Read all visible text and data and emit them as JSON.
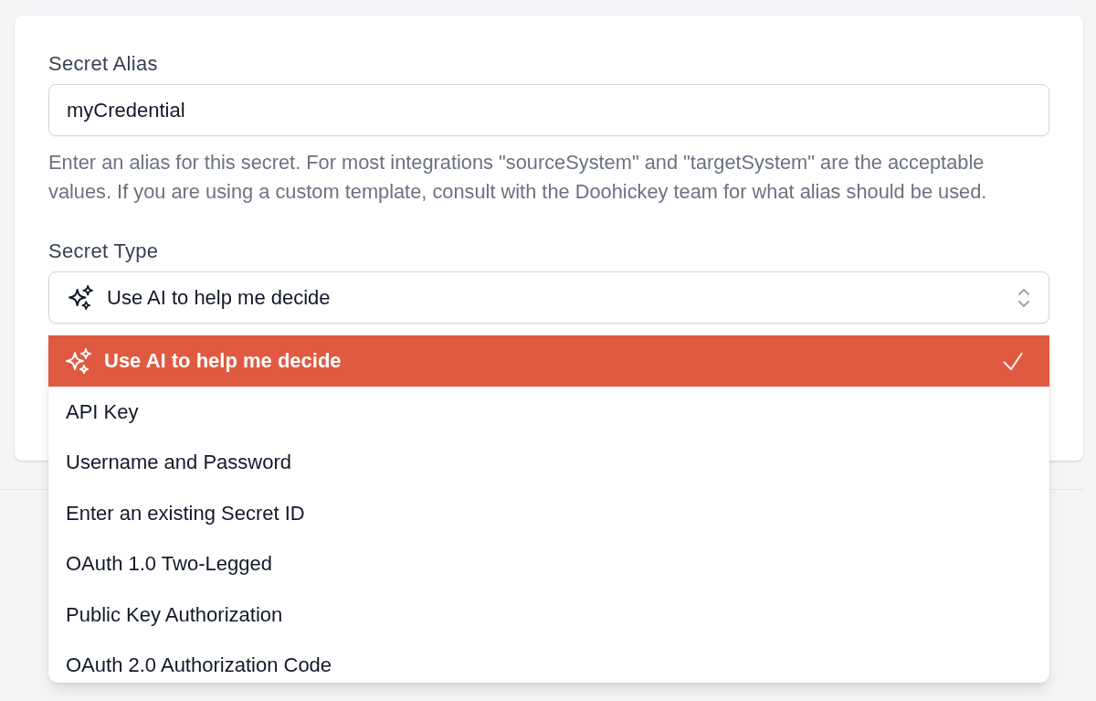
{
  "secret_alias": {
    "label": "Secret Alias",
    "value": "myCredential",
    "help": "Enter an alias for this secret. For most integrations \"sourceSystem\" and \"targetSystem\" are the acceptable values. If you are using a custom template, consult with the Doohickey team for what alias should be used."
  },
  "secret_type": {
    "label": "Secret Type",
    "value": "Use AI to help me decide",
    "expanded": true,
    "options": [
      {
        "label": "Use AI to help me decide",
        "kind": "ai",
        "selected": true
      },
      {
        "label": "API Key",
        "kind": "standard",
        "selected": false
      },
      {
        "label": "Username and Password",
        "kind": "standard",
        "selected": false
      },
      {
        "label": "Enter an existing Secret ID",
        "kind": "standard",
        "selected": false
      },
      {
        "label": "OAuth 1.0 Two-Legged",
        "kind": "standard",
        "selected": false
      },
      {
        "label": "Public Key Authorization",
        "kind": "standard",
        "selected": false
      },
      {
        "label": "OAuth 2.0 Authorization Code",
        "kind": "standard",
        "selected": false
      }
    ]
  }
}
